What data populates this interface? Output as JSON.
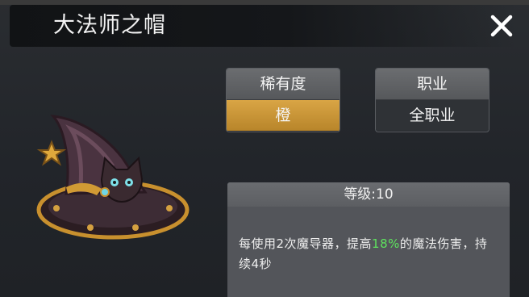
{
  "item": {
    "title": "大法师之帽"
  },
  "rarity": {
    "label": "稀有度",
    "value": "橙"
  },
  "job": {
    "label": "职业",
    "value": "全职业"
  },
  "description": {
    "level": "等级:10",
    "text_before": "每使用2次魔导器，提高",
    "highlight": "18%",
    "text_after": "的魔法伤害，持续4秒"
  },
  "icons": {
    "close": "close-icon",
    "item": "wizard-hat-cat-icon"
  },
  "colors": {
    "rarity_orange": "#c8952f",
    "highlight_green": "#5ee25e"
  }
}
